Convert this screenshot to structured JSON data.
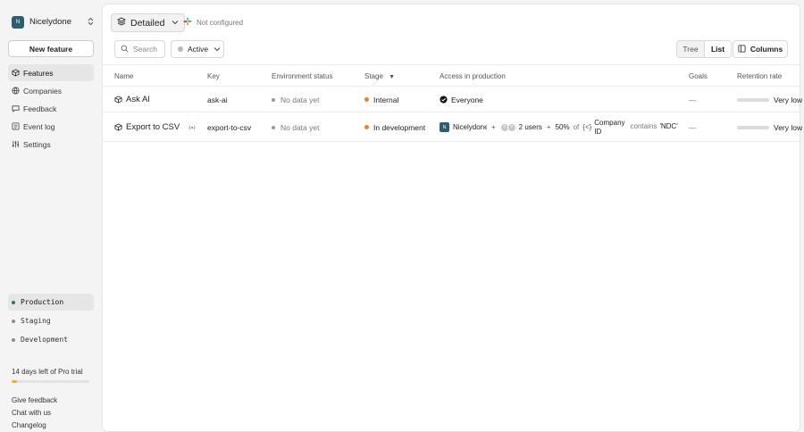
{
  "sidebar": {
    "org": {
      "initial": "N",
      "name": "Nicelydone"
    },
    "new_feature": "New feature",
    "nav": [
      {
        "label": "Features",
        "icon": "box-icon",
        "active": true
      },
      {
        "label": "Companies",
        "icon": "globe-icon"
      },
      {
        "label": "Feedback",
        "icon": "feedback-icon"
      },
      {
        "label": "Event log",
        "icon": "list-icon"
      },
      {
        "label": "Settings",
        "icon": "sliders-icon"
      }
    ],
    "environments": [
      {
        "label": "Production",
        "active": true
      },
      {
        "label": "Staging"
      },
      {
        "label": "Development"
      }
    ],
    "trial": {
      "label": "14 days left of Pro trial",
      "progress": 0.07
    },
    "links": [
      "Give feedback",
      "Chat with us",
      "Changelog"
    ]
  },
  "toolbar": {
    "view": "Detailed",
    "integration": "Not configured",
    "search_placeholder": "Search",
    "status_filter": "Active",
    "view_modes": [
      "Tree",
      "List"
    ],
    "active_view_mode": "List",
    "columns": "Columns"
  },
  "table": {
    "headers": {
      "name": "Name",
      "key": "Key",
      "env_status": "Environment status",
      "stage": "Stage",
      "access": "Access in production",
      "goals": "Goals",
      "retention": "Retention rate"
    },
    "rows": [
      {
        "name": "Ask AI",
        "key": "ask-ai",
        "env_status": "No data yet",
        "stage": "Internal",
        "stage_color": "#e8852b",
        "access": "Everyone",
        "goals": "—",
        "retention": "Very low",
        "retention_value": 0.0
      },
      {
        "name": "Export to CSV",
        "key": "export-to-csv",
        "env_status": "No data yet",
        "stage": "In development",
        "stage_color": "#e8852b",
        "access_company": "Nicelydone",
        "access_company_initial": "N",
        "access_users": "2 users",
        "access_percent": "50%",
        "access_of": "of",
        "access_attr": "Company",
        "access_attr_2": "ID",
        "access_op": "contains",
        "access_value": "'NDC'",
        "goals": "—",
        "retention": "Very low",
        "retention_value": 0.0
      }
    ]
  }
}
